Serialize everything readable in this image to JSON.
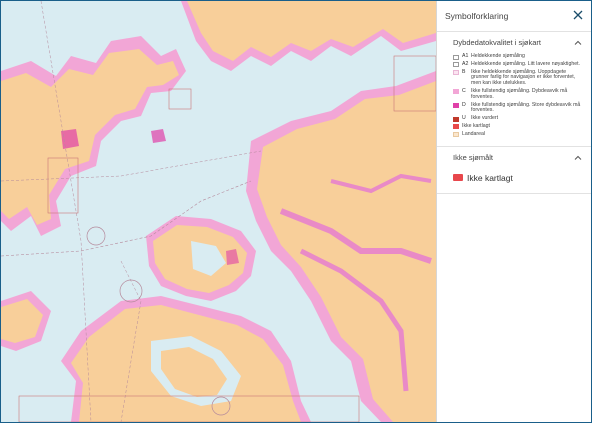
{
  "panel": {
    "title": "Symbolforklaring",
    "close_icon": "close-icon",
    "sections": [
      {
        "title": "Dybdedatokvalitet i sjøkart",
        "expanded": true,
        "items": [
          {
            "code": "A1",
            "color": "#ffffff",
            "text": "Heldekkende sjømåling"
          },
          {
            "code": "A2",
            "color": "#ffffff",
            "text": "Heldekkende sjømåling. Litt lavere nøyaktighet."
          },
          {
            "code": "B",
            "color": "#fbe4f1",
            "text": "Ikke heldekkende sjømåling. Uoppdagete grunner farlig for navigasjon er ikke forventet, men kan ikke utelukkes."
          },
          {
            "code": "C",
            "color": "#f2a6d6",
            "text": "Ikke fullstendig sjømåling. Dybdeavvik må forventes."
          },
          {
            "code": "D",
            "color": "#e040a8",
            "text": "Ikke fullstendig sjømåling. Store dybdeavvik må forventes."
          },
          {
            "code": "U",
            "color": "#c0392b",
            "text": "Ikke vurdert"
          },
          {
            "code": "",
            "color": "#e84a4a",
            "text": "Ikke kartlagt"
          },
          {
            "code": "",
            "color": "#fbe6cc",
            "text": "Landareal"
          }
        ]
      },
      {
        "title": "Ikke sjømålt",
        "expanded": true,
        "items": [
          {
            "color": "#e8474c",
            "text": "Ikke kartlagt"
          }
        ]
      }
    ]
  },
  "map": {
    "colors": {
      "sea": "#d9ecf2",
      "land": "#f8cf9a",
      "quality_c": "#f2a6d6",
      "quality_d": "#e040a8",
      "route": "#b58a9c"
    }
  }
}
